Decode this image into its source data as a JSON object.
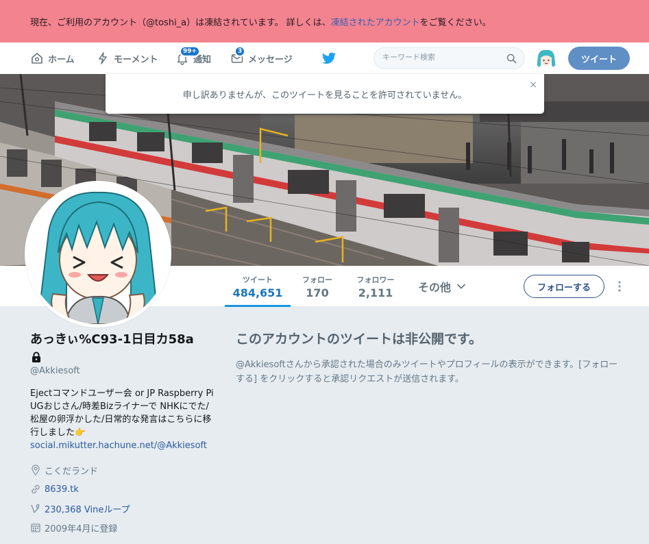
{
  "banner": {
    "text_before": "現在、ご利用のアカウント（@toshi_a）は凍結されています。 詳しくは、",
    "link_text": "凍結されたアカウント",
    "text_after": "をご覧ください。"
  },
  "nav": {
    "home_label": "ホーム",
    "moments_label": "モーメント",
    "notifications_label": "通知",
    "notifications_badge": "99+",
    "messages_label": "メッセージ",
    "messages_badge": "3",
    "search_placeholder": "キーワード検索",
    "tweet_button": "ツイート"
  },
  "toast": {
    "message": "申し訳ありませんが、このツイートを見ることを許可されていません。",
    "close": "×"
  },
  "profile_nav": {
    "tweets_label": "ツイート",
    "tweets_count": "484,651",
    "following_label": "フォロー",
    "following_count": "170",
    "followers_label": "フォロワー",
    "followers_count": "2,111",
    "more_label": "その他",
    "follow_button": "フォローする"
  },
  "profile": {
    "display_name": "あっきぃ%C93-1日目カ58a",
    "handle": "@Akkiesoft",
    "bio": "Ejectコマンドユーザー会 or JP Raspberry Pi UGおじさん/時差Bizライナーで NHKにでた/松屋の卵浮かした/日常的な発言はこちらに移行しました👉",
    "bio_link": "social.mikutter.hachune.net/@Akkiesoft",
    "location": "こくだランド",
    "website": "8639.tk",
    "vine": "230,368 Vineループ",
    "joined": "2009年4月に登録"
  },
  "protected_notice": {
    "title": "このアカウントのツイートは非公開です。",
    "body": "@Akkiesoftさんから承認された場合のみツイートやプロフィールの表示ができます。[フォローする] をクリックすると承認リクエストが送信されます。"
  },
  "colors": {
    "banner_bg": "#f2838f",
    "link": "#2b5a9e",
    "tweet_button_bg": "#5f8fc5",
    "active_tab": "#1b95e0"
  },
  "icons": [
    "home-icon",
    "lightning-icon",
    "bell-icon",
    "envelope-icon",
    "twitter-bird-icon",
    "search-icon",
    "chevron-down-icon",
    "kebab-icon",
    "lock-icon",
    "location-icon",
    "link-icon",
    "vine-icon",
    "calendar-icon",
    "close-icon"
  ]
}
